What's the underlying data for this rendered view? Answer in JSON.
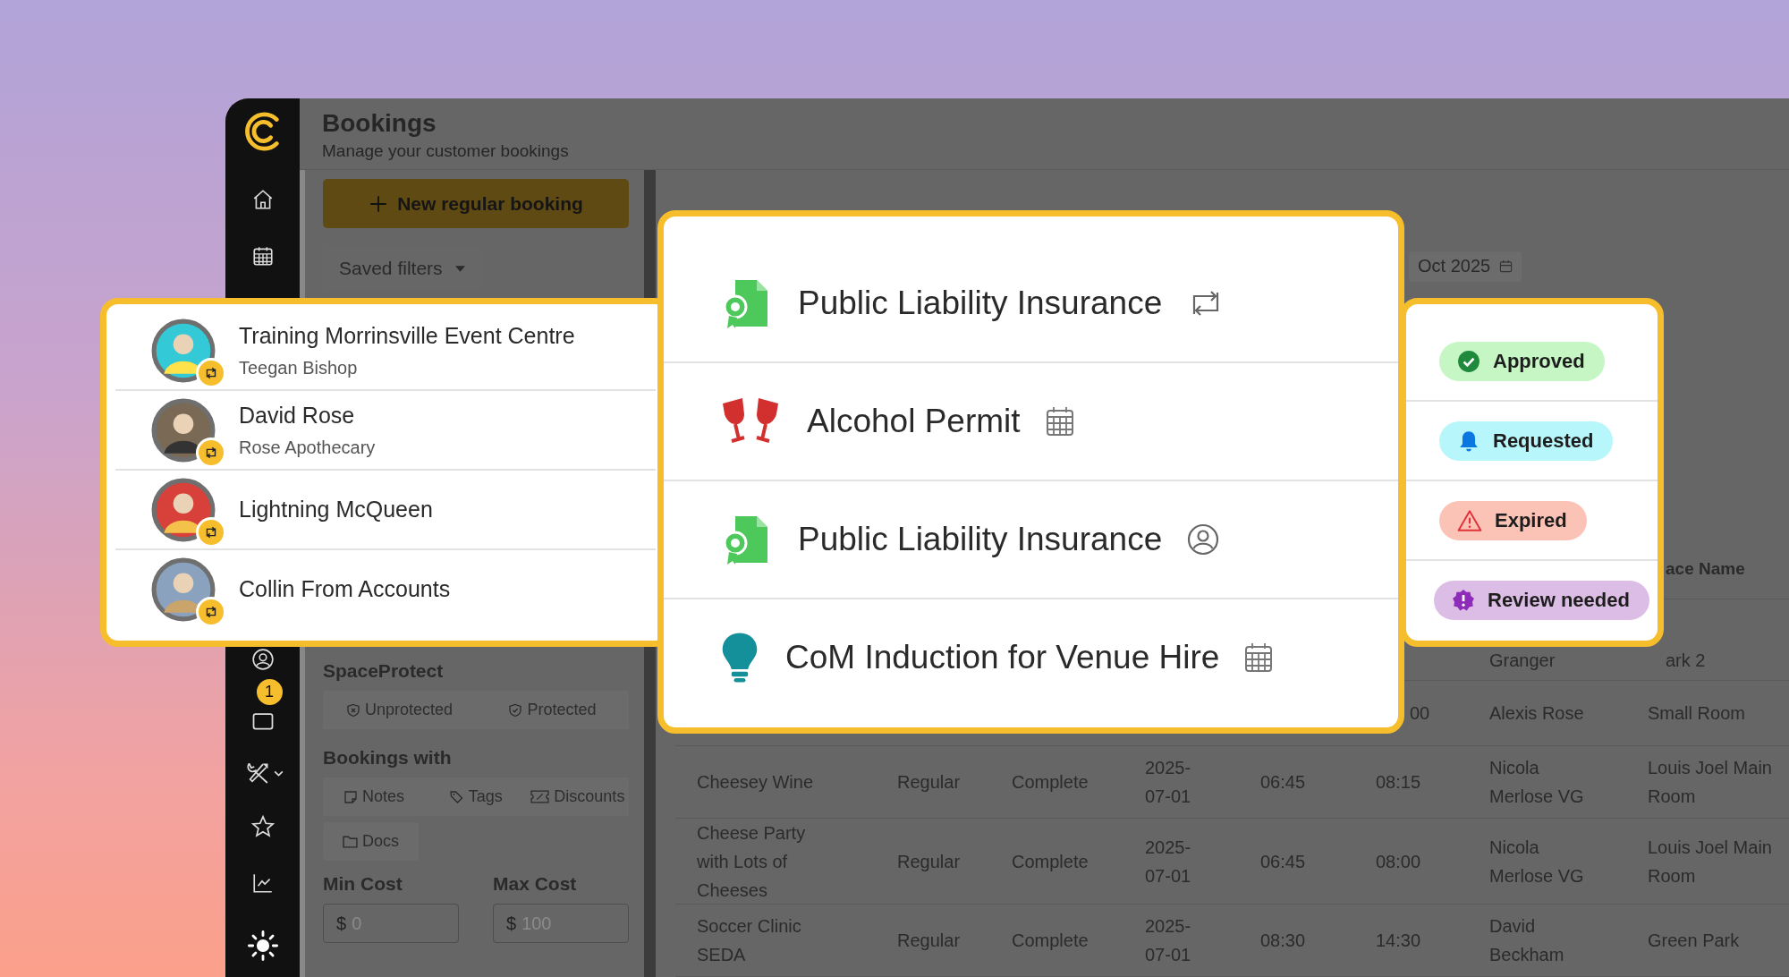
{
  "app": {
    "title": "Bookings",
    "subtitle": "Manage your customer bookings",
    "inbox_badge": "1"
  },
  "filters": {
    "new_button": "New regular booking",
    "saved_filters": "Saved filters",
    "space_protect": {
      "heading": "SpaceProtect",
      "options": [
        {
          "label": "Unprotected",
          "kind": "unprotected"
        },
        {
          "label": "Protected",
          "kind": "protected"
        }
      ]
    },
    "bookings_with": {
      "heading": "Bookings with",
      "options": [
        {
          "label": "Notes",
          "kind": "notes"
        },
        {
          "label": "Tags",
          "kind": "tags"
        },
        {
          "label": "Discounts",
          "kind": "discounts"
        },
        {
          "label": "Docs",
          "kind": "docs"
        }
      ]
    },
    "min_cost": {
      "label": "Min Cost",
      "prefix": "$",
      "placeholder": "0"
    },
    "max_cost": {
      "label": "Max Cost",
      "prefix": "$",
      "placeholder": "100"
    }
  },
  "date_field": {
    "value": "Oct 2025"
  },
  "table": {
    "column_8_header": "ace Name",
    "rows": [
      {
        "column_7": "Granger",
        "column_8": "ark 2"
      },
      {
        "column_6": "00",
        "column_7": "Alexis Rose",
        "column_8": "Small Room"
      },
      {
        "column_1": "Cheesey Wine",
        "column_2": "Regular",
        "column_3": "Complete",
        "column_4": "2025-07-01",
        "column_5": "06:45",
        "column_6": "08:15",
        "column_7": "Nicola Merlose VG",
        "column_8": "Louis Joel Main Room"
      },
      {
        "column_1": "Cheese Party with Lots of Cheeses",
        "column_2": "Regular",
        "column_3": "Complete",
        "column_4": "2025-07-01",
        "column_5": "06:45",
        "column_6": "08:00",
        "column_7": "Nicola Merlose VG",
        "column_8": "Louis Joel Main Room"
      },
      {
        "column_1": "Soccer Clinic SEDA",
        "column_2": "Regular",
        "column_3": "Complete",
        "column_4": "2025-07-01",
        "column_5": "08:30",
        "column_6": "14:30",
        "column_7": "David Beckham",
        "column_8": "Green Park"
      }
    ]
  },
  "customers": [
    {
      "name": "Training Morrinsville Event Centre",
      "detail": "Teegan Bishop",
      "recurring": true
    },
    {
      "name": "David Rose",
      "detail": "Rose Apothecary",
      "recurring": true
    },
    {
      "name": "Lightning McQueen",
      "recurring": true
    },
    {
      "name": "Collin From Accounts",
      "recurring": true
    }
  ],
  "documents": [
    {
      "title": "Public Liability Insurance",
      "kind": "insurance",
      "trigger": {
        "kind": "recurring"
      }
    },
    {
      "title": "Alcohol Permit",
      "kind": "permit",
      "trigger": {
        "kind": "dated"
      }
    },
    {
      "title": "Public Liability Insurance",
      "kind": "insurance",
      "trigger": {
        "kind": "customer"
      }
    },
    {
      "title": "CoM Induction for Venue Hire",
      "kind": "induction",
      "trigger": {
        "kind": "dated"
      }
    }
  ],
  "statuses": [
    {
      "label": "Approved",
      "kind": "approved"
    },
    {
      "label": "Requested",
      "kind": "requested"
    },
    {
      "label": "Expired",
      "kind": "expired"
    },
    {
      "label": "Review needed",
      "kind": "review"
    }
  ]
}
